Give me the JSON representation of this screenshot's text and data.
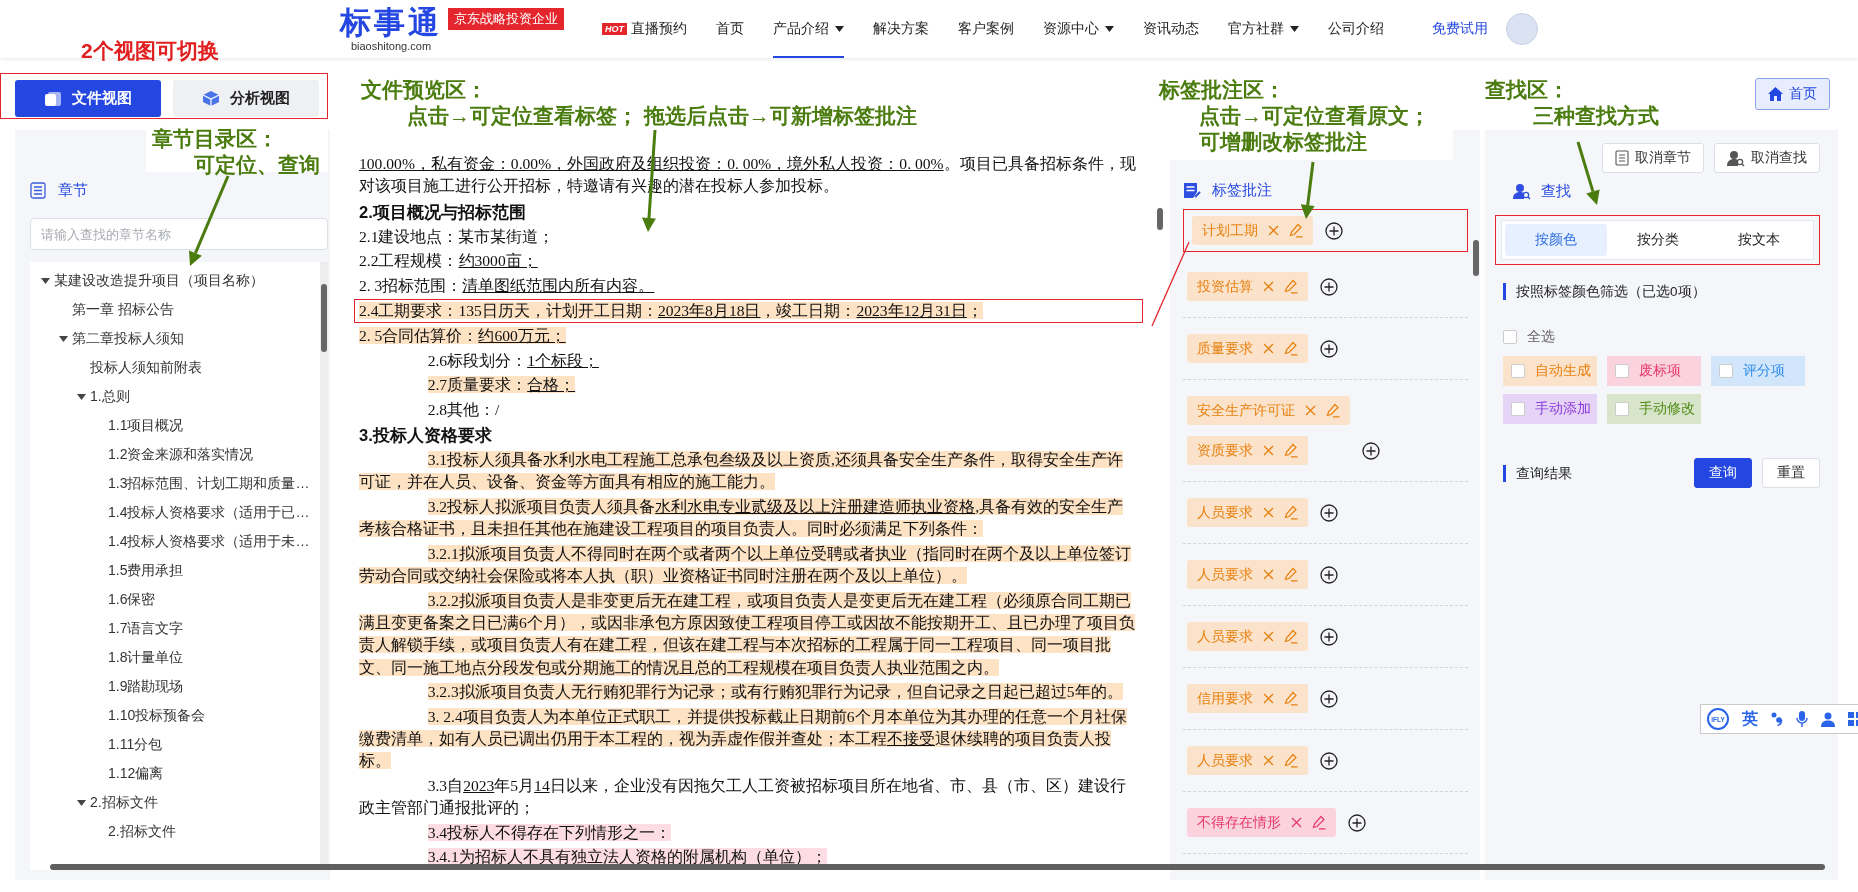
{
  "nav": {
    "logo": {
      "brand": "标事通",
      "domain": "biaoshitong.com",
      "badge": "京东战略投资企业"
    },
    "items": [
      {
        "label": "直播预约",
        "badge": "HOT",
        "dropdown": false,
        "selected": false
      },
      {
        "label": "首页",
        "dropdown": false,
        "selected": false
      },
      {
        "label": "产品介绍",
        "dropdown": true,
        "selected": true
      },
      {
        "label": "解决方案",
        "dropdown": false,
        "selected": false
      },
      {
        "label": "客户案例",
        "dropdown": false,
        "selected": false
      },
      {
        "label": "资源中心",
        "dropdown": true,
        "selected": false
      },
      {
        "label": "资讯动态",
        "dropdown": false,
        "selected": false
      },
      {
        "label": "官方社群",
        "dropdown": true,
        "selected": false
      },
      {
        "label": "公司介绍",
        "dropdown": false,
        "selected": false
      }
    ],
    "trial": "免费试用"
  },
  "view_switch": {
    "outlined": true,
    "buttons": [
      {
        "label": "文件视图",
        "selected": true
      },
      {
        "label": "分析视图",
        "selected": false
      }
    ]
  },
  "home_button": "首页",
  "chapters": {
    "title": "章节",
    "search": {
      "placeholder": "请输入查找的章节名称"
    },
    "tree": [
      {
        "label": "某建设改造提升项目（项目名称）",
        "expanded": true,
        "children": [
          {
            "label": "第一章 招标公告"
          },
          {
            "label": "第二章投标人须知",
            "expanded": true,
            "children": [
              {
                "label": "投标人须知前附表"
              },
              {
                "label": "1.总则",
                "expanded": true,
                "children": [
                  {
                    "label": "1.1项目概况"
                  },
                  {
                    "label": "1.2资金来源和落实情况"
                  },
                  {
                    "label": "1.3招标范围、计划工期和质量…"
                  },
                  {
                    "label": "1.4投标人资格要求（适用于已…"
                  },
                  {
                    "label": "1.4投标人资格要求（适用于未…"
                  },
                  {
                    "label": "1.5费用承担"
                  },
                  {
                    "label": "1.6保密"
                  },
                  {
                    "label": "1.7语言文字"
                  },
                  {
                    "label": "1.8计量单位"
                  },
                  {
                    "label": "1.9踏勘现场"
                  },
                  {
                    "label": "1.10投标预备会"
                  },
                  {
                    "label": "1.11分包"
                  },
                  {
                    "label": "1.12偏离"
                  }
                ]
              },
              {
                "label": "2.招标文件",
                "expanded": true,
                "children": [
                  {
                    "label": "2.招标文件"
                  }
                ]
              }
            ]
          }
        ]
      }
    ]
  },
  "document": {
    "paragraphs": [
      {
        "kind": "text",
        "indented": false,
        "outlined": false,
        "parts": [
          {
            "text": "100.00%，私有资金：0.00%，外国政府及组织投资：0.  00%，境外私人投资：0.  00%",
            "underline": true
          },
          {
            "text": "。项目已具备招标条件，现对该项目施工进行公开招标，特邀请有兴趣的潜在投标人参加投标。",
            "underline": false
          }
        ]
      },
      {
        "kind": "heading",
        "indented": false,
        "outlined": false,
        "parts": [
          {
            "text": "2.项目概况与招标范围",
            "underline": false
          }
        ]
      },
      {
        "kind": "text",
        "indented": false,
        "outlined": false,
        "parts": [
          {
            "text": "2.1建设地点：某市某街道；",
            "underline": false
          }
        ]
      },
      {
        "kind": "text",
        "indented": false,
        "outlined": false,
        "parts": [
          {
            "text": "2.2工程规模：",
            "underline": false
          },
          {
            "text": "约3000亩；",
            "underline": true
          }
        ]
      },
      {
        "kind": "text",
        "indented": false,
        "outlined": false,
        "parts": [
          {
            "text": "2.  3招标范围：",
            "underline": false
          },
          {
            "text": "清单图纸范围内所有内容。",
            "underline": true
          }
        ]
      },
      {
        "kind": "text",
        "indented": false,
        "color": "#fde2c4",
        "outlined": true,
        "parts": [
          {
            "text": "2.4工期要求：135日历天，计划开工日期：",
            "underline": false
          },
          {
            "text": "2023年8月18日",
            "underline": true
          },
          {
            "text": "，竣工日期：",
            "underline": false
          },
          {
            "text": "2023年12月31日",
            "underline": true
          },
          {
            "text": "；",
            "underline": false
          }
        ]
      },
      {
        "kind": "text",
        "indented": false,
        "color": "#fde2c4",
        "outlined": false,
        "parts": [
          {
            "text": "2.  5合同估算价：",
            "underline": false
          },
          {
            "text": "约600万元；",
            "underline": true
          }
        ]
      },
      {
        "kind": "text",
        "indented": true,
        "outlined": false,
        "parts": [
          {
            "text": "2.6标段划分：",
            "underline": false
          },
          {
            "text": "1个标段；",
            "underline": true
          }
        ]
      },
      {
        "kind": "text",
        "indented": true,
        "color": "#fde2c4",
        "outlined": false,
        "parts": [
          {
            "text": "2.7质量要求：",
            "underline": false
          },
          {
            "text": "合格；",
            "underline": true
          }
        ]
      },
      {
        "kind": "text",
        "indented": true,
        "outlined": false,
        "parts": [
          {
            "text": "2.8其他：/",
            "underline": false
          }
        ]
      },
      {
        "kind": "heading",
        "indented": false,
        "outlined": false,
        "parts": [
          {
            "text": "3.投标人资格要求",
            "underline": false
          }
        ]
      },
      {
        "kind": "text",
        "indented": true,
        "color": "#fde2c4",
        "outlined": false,
        "parts": [
          {
            "text": "3.1投标人须具备水利水电工程施工总承包叁级及以上资质,还须具备安全生产条件，取得安全生产许可证，并在人员、设备、资金等方面具有相应的施工能力。",
            "underline": false
          }
        ]
      },
      {
        "kind": "text",
        "indented": true,
        "color": "#fde2c4",
        "outlined": false,
        "parts": [
          {
            "text": "3.2投标人拟派项目负责人须具备",
            "underline": false
          },
          {
            "text": "水利水电专业贰级及以上注册建造师执业资格",
            "underline": true
          },
          {
            "text": ",具备有效的安全生产考核合格证书，且未担任其他在施建设工程项目的项目负责人。同时必须满足下列条件：",
            "underline": false
          }
        ]
      },
      {
        "kind": "text",
        "indented": true,
        "color": "#fde2c4",
        "outlined": false,
        "parts": [
          {
            "text": "3.2.1拟派项目负责人不得同时在两个或者两个以上单位受聘或者执业（指同时在两个及以上单位签订劳动合同或交纳社会保险或将本人执（职）业资格证书同时注册在两个及以上单位）。",
            "underline": false
          }
        ]
      },
      {
        "kind": "text",
        "indented": true,
        "color": "#fde2c4",
        "outlined": false,
        "parts": [
          {
            "text": "3.2.2拟派项目负责人是非变更后无在建工程，或项目负责人是变更后无在建工程（必须原合同工期已满且变更备案之日已满6个月），或因非承包方原因致使工程项目停工或因故不能按期开工、且已办理了项目负责人解锁手续，或项目负责人有在建工程，但该在建工程与本次招标的工程属于同一工程项目、同一项目批文、同一施工地点分段发包或分期施工的情况且总的工程规模在项目负责人执业范围之内。",
            "underline": false
          }
        ]
      },
      {
        "kind": "text",
        "indented": true,
        "color": "#fde2c4",
        "outlined": false,
        "parts": [
          {
            "text": "3.2.3拟派项目负责人无行贿犯罪行为记录；或有行贿犯罪行为记录，但自记录之日起已超过5年的。",
            "underline": false
          }
        ]
      },
      {
        "kind": "text",
        "indented": true,
        "color": "#fde2c4",
        "outlined": false,
        "parts": [
          {
            "text": "3.  2.4项目负责人为本单位正式职工，并提供投标截止日期前6个月本单位为其办理的任意一个月社保缴费清单，如有人员已调出仍用于本工程的，视为弄虚作假并查处；本工程",
            "underline": false
          },
          {
            "text": "不接受",
            "underline": true
          },
          {
            "text": "退休续聘的项目负责人投标。",
            "underline": false
          }
        ]
      },
      {
        "kind": "text",
        "indented": true,
        "outlined": false,
        "parts": [
          {
            "text": "3.3自",
            "underline": false
          },
          {
            "text": "2023",
            "underline": true
          },
          {
            "text": "年5月",
            "underline": false
          },
          {
            "text": "14",
            "underline": true
          },
          {
            "text": "日以来，企业没有因拖欠工人工资被招标项目所在地省、市、县（市、区）建设行政主管部门通报批评的；",
            "underline": false
          }
        ]
      },
      {
        "kind": "text",
        "indented": true,
        "color": "#fddde3",
        "outlined": false,
        "parts": [
          {
            "text": "3.4投标人不得存在下列情形之一：",
            "underline": false
          }
        ]
      },
      {
        "kind": "text",
        "indented": true,
        "color": "#fddde3",
        "outlined": false,
        "parts": [
          {
            "text": "3.4.1为招标人不具有独立法人资格的附属机构（单位）；",
            "underline": false
          }
        ]
      }
    ]
  },
  "tags": {
    "title": "标签批注",
    "groups": [
      {
        "outlined": true,
        "tags": [
          {
            "label": "计划工期",
            "color": "#e8800f"
          }
        ]
      },
      {
        "outlined": false,
        "tags": [
          {
            "label": "投资估算",
            "color": "#e8800f"
          }
        ]
      },
      {
        "outlined": false,
        "tags": [
          {
            "label": "质量要求",
            "color": "#e8800f"
          }
        ]
      },
      {
        "outlined": false,
        "tags": [
          {
            "label": "安全生产许可证",
            "color": "#e8800f"
          },
          {
            "label": "资质要求",
            "color": "#e8800f"
          }
        ]
      },
      {
        "outlined": false,
        "tags": [
          {
            "label": "人员要求",
            "color": "#e8800f"
          }
        ]
      },
      {
        "outlined": false,
        "tags": [
          {
            "label": "人员要求",
            "color": "#e8800f"
          }
        ]
      },
      {
        "outlined": false,
        "tags": [
          {
            "label": "人员要求",
            "color": "#e8800f"
          }
        ]
      },
      {
        "outlined": false,
        "tags": [
          {
            "label": "信用要求",
            "color": "#e8800f"
          }
        ]
      },
      {
        "outlined": false,
        "tags": [
          {
            "label": "人员要求",
            "color": "#e8800f"
          }
        ]
      },
      {
        "outlined": false,
        "tags": [
          {
            "label": "不得存在情形",
            "color": "#e8386a"
          }
        ]
      }
    ]
  },
  "find": {
    "actions": [
      "取消章节",
      "取消查找"
    ],
    "title": "查找",
    "outlined": true,
    "tabs": [
      {
        "label": "按颜色",
        "selected": true
      },
      {
        "label": "按分类",
        "selected": false
      },
      {
        "label": "按文本",
        "selected": false
      }
    ],
    "filter_heading": "按照标签颜色筛选（已选0项）",
    "select_all": {
      "label": "全选",
      "checked": false
    },
    "color_filters": [
      {
        "label": "自动生成",
        "color": "#e8800f",
        "checked": false
      },
      {
        "label": "废标项",
        "color": "#e8386a",
        "checked": false
      },
      {
        "label": "评分项",
        "color": "#2f8ce8",
        "checked": false
      },
      {
        "label": "手动添加",
        "color": "#8a3ad8",
        "checked": false
      },
      {
        "label": "手动修改",
        "color": "#4d8a12",
        "checked": false
      }
    ],
    "results_label": "查询结果",
    "query_button": "查询",
    "reset_button": "重置"
  },
  "annotations": [
    {
      "color": "#e02020",
      "lines": [
        "2个视图可切换"
      ]
    },
    {
      "color": "#4b7c0f",
      "lines": [
        "文件预览区：",
        "点击→可定位查看标签； 拖选后点击→可新增标签批注"
      ]
    },
    {
      "color": "#4b7c0f",
      "lines": [
        "章节目录区：",
        "可定位、查询"
      ]
    },
    {
      "color": "#4b7c0f",
      "lines": [
        "标签批注区：",
        "点击→可定位查看原文；",
        "可增删改标签批注"
      ]
    },
    {
      "color": "#4b7c0f",
      "lines": [
        "查找区：",
        "三种查找方式"
      ]
    }
  ],
  "input_toolbar": {
    "logo": "iFLY",
    "language": "英"
  }
}
